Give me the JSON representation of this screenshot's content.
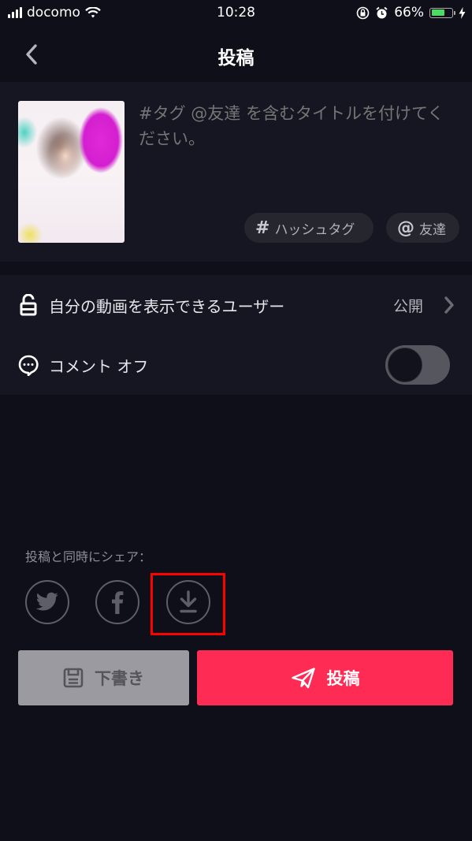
{
  "status_bar": {
    "carrier": "docomo",
    "time": "10:28",
    "battery_percent": "66%",
    "battery_level": 0.66,
    "icons": [
      "signal-icon",
      "wifi-icon",
      "rotation-lock-icon",
      "alarm-icon",
      "battery-icon",
      "charging-icon"
    ]
  },
  "nav": {
    "title": "投稿",
    "back_icon": "chevron-left-icon"
  },
  "caption": {
    "placeholder": "#タグ @友達 を含むタイトルを付けてください。",
    "value": "",
    "chips": [
      {
        "symbol": "#",
        "label": "ハッシュタグ"
      },
      {
        "symbol": "@",
        "label": "友達"
      }
    ]
  },
  "settings": {
    "privacy": {
      "label": "自分の動画を表示できるユーザー",
      "value": "公開",
      "icon": "unlock-icon"
    },
    "comments": {
      "label": "コメント オフ",
      "icon": "comment-icon",
      "toggle_on": false
    }
  },
  "share": {
    "label": "投稿と同時にシェア：",
    "targets": [
      "twitter-icon",
      "facebook-icon",
      "download-icon"
    ]
  },
  "buttons": {
    "draft_label": "下書き",
    "post_label": "投稿"
  },
  "colors": {
    "accent": "#fe2c55",
    "background": "#0f0f1a",
    "card": "#161622",
    "highlight": "#ff0000"
  }
}
